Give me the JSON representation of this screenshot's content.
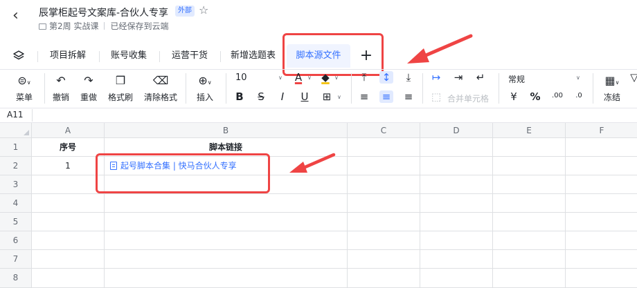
{
  "header": {
    "title": "辰掌柜起号文案库-合伙人专享",
    "badge": "外部",
    "location": "第2周 实战课",
    "save_status": "已经保存到云端"
  },
  "tabs": [
    {
      "label": "项目拆解"
    },
    {
      "label": "账号收集"
    },
    {
      "label": "运营干货"
    },
    {
      "label": "新增选题表"
    },
    {
      "label": "脚本源文件",
      "active": true
    }
  ],
  "toolbar": {
    "menu": "菜单",
    "undo": "撤销",
    "redo": "重做",
    "format_painter": "格式刷",
    "clear_format": "清除格式",
    "insert": "插入",
    "font_size": "10",
    "merge_cells": "合并单元格",
    "number_format": "常规",
    "freeze": "冻结",
    "currency": "¥",
    "percent": "%",
    "dec_decrease": ".00",
    "dec_increase": ".0"
  },
  "formula_bar": {
    "cell_ref": "A11"
  },
  "sheet": {
    "columns": [
      "A",
      "B",
      "C",
      "D",
      "E",
      "F"
    ],
    "rows": [
      "1",
      "2",
      "3",
      "4",
      "5",
      "6",
      "7",
      "8"
    ],
    "cells": {
      "A1": "序号",
      "B1": "脚本链接",
      "A2": "1",
      "B2": "起号脚本合集 | 快马合伙人专享"
    }
  },
  "colors": {
    "accent": "#3370ff",
    "annotation": "#ef4444"
  }
}
